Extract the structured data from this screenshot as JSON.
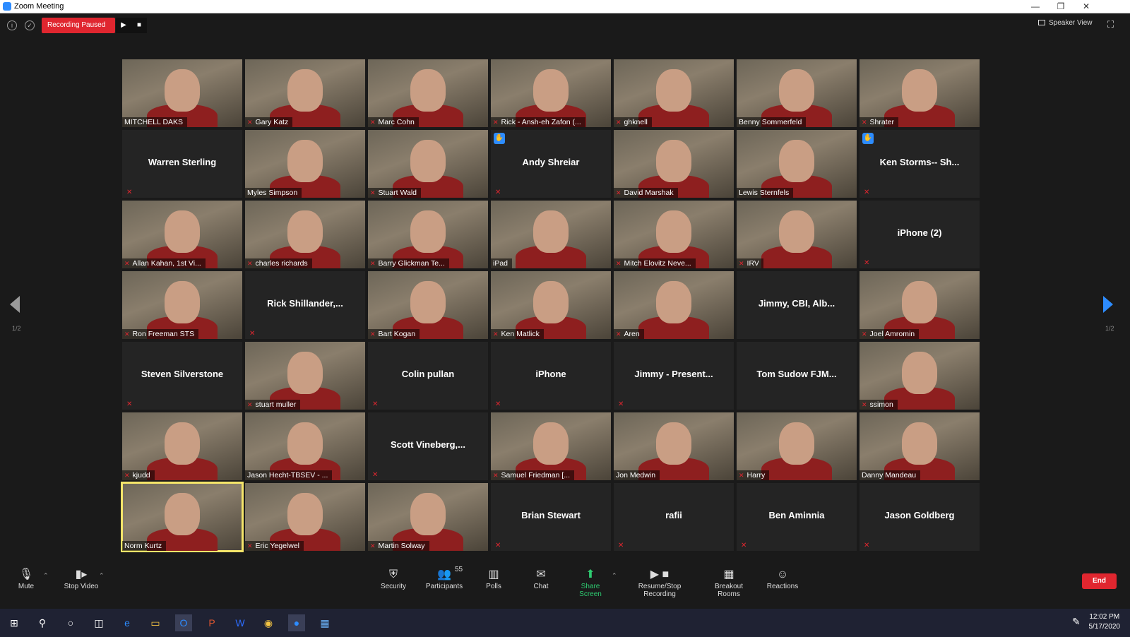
{
  "window": {
    "title": "Zoom Meeting"
  },
  "topbar": {
    "recording_status": "Recording Paused",
    "speaker_view": "Speaker View",
    "page": "1/2"
  },
  "tiles": [
    {
      "name": "MITCHELL DAKS",
      "video": true
    },
    {
      "name": "Gary Katz",
      "video": true,
      "muted": true
    },
    {
      "name": "Marc Cohn",
      "video": true,
      "muted": true
    },
    {
      "name": "Rick - Ansh-eh Zafon (...",
      "video": true,
      "muted": true
    },
    {
      "name": "ghknell",
      "video": true,
      "muted": true
    },
    {
      "name": "Benny Sommerfeld",
      "video": true
    },
    {
      "name": "Shrater",
      "video": true,
      "muted": true
    },
    {
      "name": "Warren Sterling",
      "video": false,
      "muted": true
    },
    {
      "name": "Myles Simpson",
      "video": true
    },
    {
      "name": "Stuart Wald",
      "video": true,
      "muted": true
    },
    {
      "name": "Andy Shreiar",
      "video": false,
      "muted": true,
      "hand": true
    },
    {
      "name": "David Marshak",
      "video": true,
      "muted": true
    },
    {
      "name": "Lewis Sternfels",
      "video": true
    },
    {
      "name": "Ken Storms-- Sh...",
      "video": false,
      "muted": true,
      "hand": true
    },
    {
      "name": "Allan Kahan, 1st Vi...",
      "video": true,
      "muted": true
    },
    {
      "name": "charles richards",
      "video": true,
      "muted": true
    },
    {
      "name": "Barry Glickman Te...",
      "video": true,
      "muted": true
    },
    {
      "name": "iPad",
      "video": true
    },
    {
      "name": "Mitch Elovitz Neve...",
      "video": true,
      "muted": true
    },
    {
      "name": "IRV",
      "video": true,
      "muted": true
    },
    {
      "name": "iPhone (2)",
      "video": false,
      "muted": true
    },
    {
      "name": "Ron Freeman STS",
      "video": true,
      "muted": true
    },
    {
      "name": "Rick  Shillander,...",
      "video": false,
      "muted": true
    },
    {
      "name": "Bart Kogan",
      "video": true,
      "muted": true
    },
    {
      "name": "Ken Matlick",
      "video": true,
      "muted": true
    },
    {
      "name": "Aren",
      "video": true,
      "muted": true
    },
    {
      "name": "Jimmy, CBI, Alb...",
      "video": false
    },
    {
      "name": "Joel Amromin",
      "video": true,
      "muted": true
    },
    {
      "name": "Steven Silverstone",
      "video": false,
      "muted": true
    },
    {
      "name": "stuart muller",
      "video": true,
      "muted": true
    },
    {
      "name": "Colin pullan",
      "video": false,
      "muted": true
    },
    {
      "name": "iPhone",
      "video": false,
      "muted": true
    },
    {
      "name": "Jimmy - Present...",
      "video": false,
      "muted": true
    },
    {
      "name": "Tom Sudow FJM...",
      "video": false
    },
    {
      "name": "ssimon",
      "video": true,
      "muted": true
    },
    {
      "name": "kjudd",
      "video": true,
      "muted": true
    },
    {
      "name": "Jason Hecht-TBSEV - ...",
      "video": true
    },
    {
      "name": "Scott  Vineberg,...",
      "video": false,
      "muted": true
    },
    {
      "name": "Samuel Friedman [...",
      "video": true,
      "muted": true
    },
    {
      "name": "Jon Medwin",
      "video": true
    },
    {
      "name": "Harry",
      "video": true,
      "muted": true
    },
    {
      "name": "Danny Mandeau",
      "video": true
    },
    {
      "name": "Norm Kurtz",
      "video": true,
      "active": true
    },
    {
      "name": "Eric Yegelwel",
      "video": true,
      "muted": true
    },
    {
      "name": "Martin Solway",
      "video": true,
      "muted": true
    },
    {
      "name": "Brian Stewart",
      "video": false,
      "muted": true
    },
    {
      "name": "rafii",
      "video": false,
      "muted": true
    },
    {
      "name": "Ben Aminnia",
      "video": false,
      "muted": true
    },
    {
      "name": "Jason Goldberg",
      "video": false,
      "muted": true
    }
  ],
  "toolbar": {
    "mute": "Mute",
    "stop_video": "Stop Video",
    "security": "Security",
    "participants": "Participants",
    "participants_count": "55",
    "polls": "Polls",
    "chat": "Chat",
    "share_screen": "Share Screen",
    "recording": "Resume/Stop Recording",
    "breakout": "Breakout Rooms",
    "reactions": "Reactions",
    "end": "End"
  },
  "taskbar": {
    "time": "12:02 PM",
    "date": "5/17/2020"
  },
  "colors": {
    "recording": "#e0262f",
    "active_speaker": "#f5e56a",
    "accent": "#2d8cff",
    "share": "#2ecc71"
  }
}
